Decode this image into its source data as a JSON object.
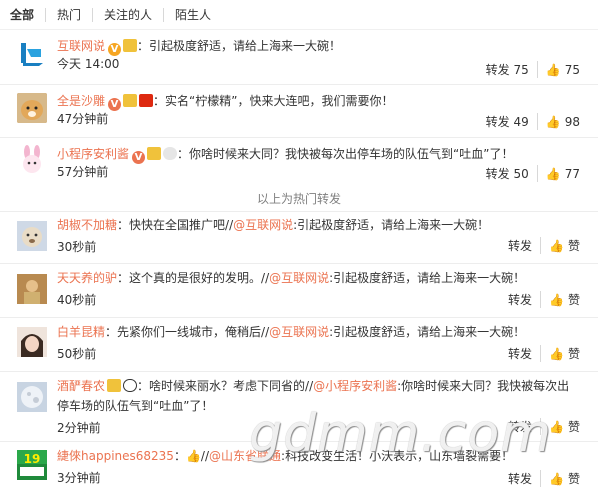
{
  "tabs": [
    "全部",
    "热门",
    "关注的人",
    "陌生人"
  ],
  "hot_divider": "以上为热门转发",
  "repost_label": "转发",
  "like_label": "赞",
  "posts": [
    {
      "user": "互联网说",
      "sep": "：",
      "text": "引起极度舒适，请给上海来一大碗！",
      "time": "今天 14:00",
      "reposts": "75",
      "likes": "75"
    },
    {
      "user": "全是沙雕",
      "sep": "：",
      "text": "实名“柠檬精”，快来大连吧，我们需要你！",
      "time": "47分钟前",
      "reposts": "49",
      "likes": "98"
    },
    {
      "user": "小程序安利酱",
      "sep": "：",
      "text": "你啥时候来大同？我快被每次出停车场的队伍气到“吐血”了！",
      "time": "57分钟前",
      "reposts": "50",
      "likes": "77"
    },
    {
      "user": "胡椒不加糖",
      "sep": "：",
      "text": "快快在全国推广吧//",
      "mention": "@互联网说",
      "text2": ":引起极度舒适，请给上海来一大碗！",
      "time": "30秒前"
    },
    {
      "user": "天天养的驴",
      "sep": "：",
      "text": "这个真的是很好的发明。//",
      "mention": "@互联网说",
      "text2": ":引起极度舒适，请给上海来一大碗！",
      "time": "40秒前"
    },
    {
      "user": "白羊昆精",
      "sep": "：",
      "text": "先紧你们一线城市，俺稍后//",
      "mention": "@互联网说",
      "text2": ":引起极度舒适，请给上海来一大碗！",
      "time": "50秒前"
    },
    {
      "user": "酒酽春农",
      "sep": "：",
      "text": "啥时候来丽水？考虑下同省的//",
      "mention": "@小程序安利酱",
      "text2": ":你啥时候来大同？我快被每次出",
      "line2": "停车场的队伍气到“吐血”了！",
      "time": "2分钟前"
    },
    {
      "user": "緁倈happines68235",
      "sep": "：",
      "text": "//",
      "mention": "@山东省联通",
      "text2": ":科技改变生活！小沃表示，山东墙裂需要！",
      "time": "3分钟前"
    }
  ],
  "watermark": "gdmm.com"
}
